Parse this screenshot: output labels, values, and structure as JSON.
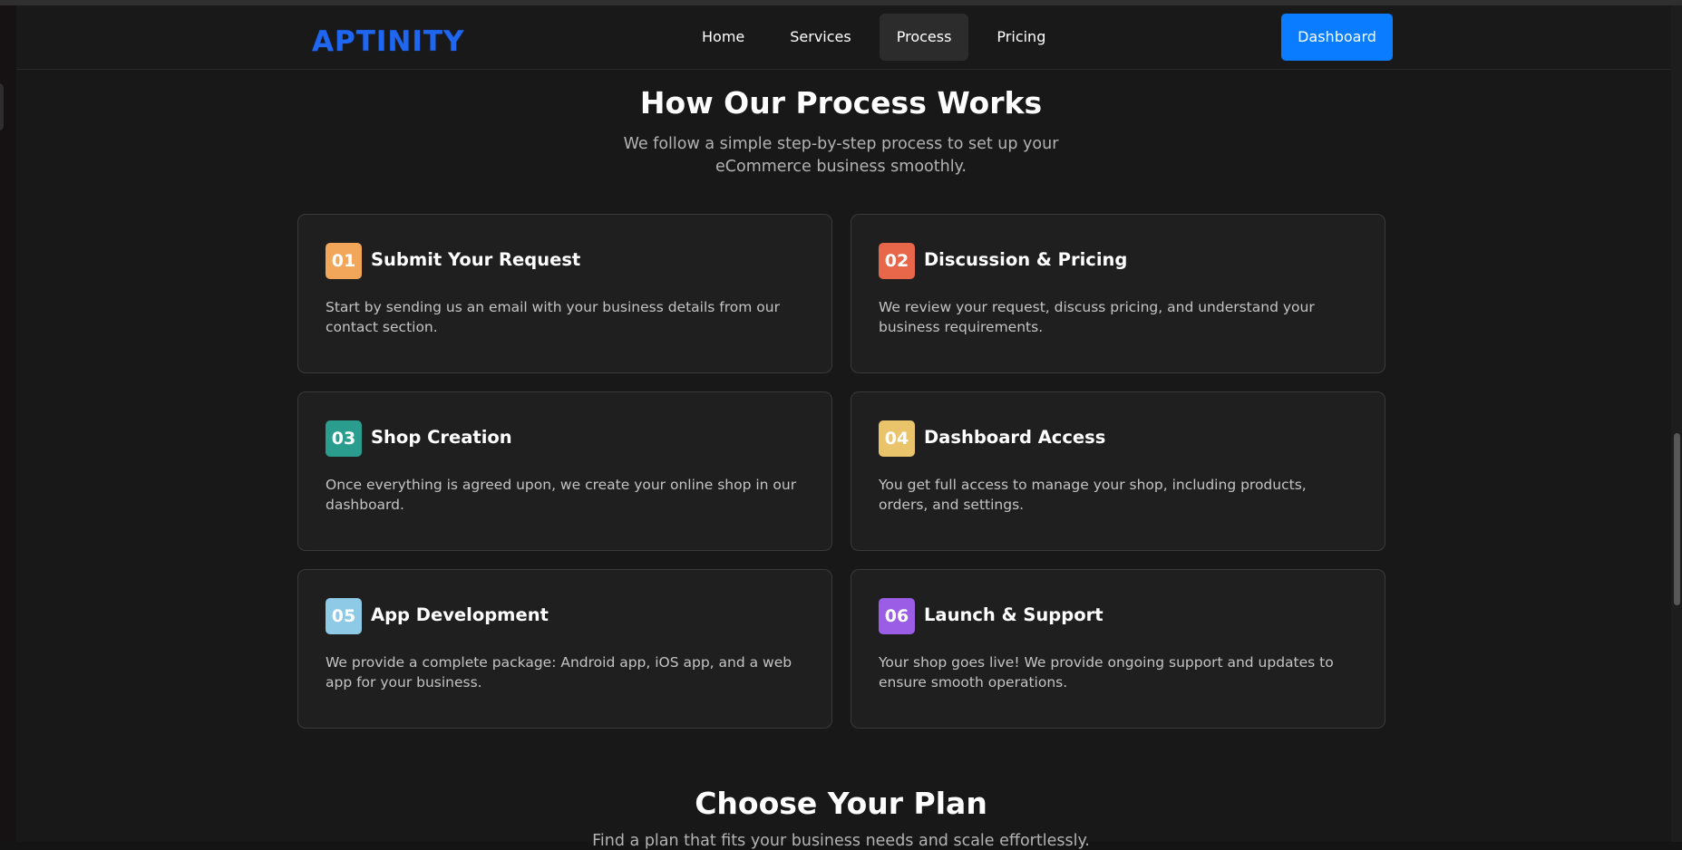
{
  "navbar": {
    "logo": "APTINITY",
    "links": [
      {
        "label": "Home",
        "active": false
      },
      {
        "label": "Services",
        "active": false
      },
      {
        "label": "Process",
        "active": true
      },
      {
        "label": "Pricing",
        "active": false
      }
    ],
    "dashboard_label": "Dashboard"
  },
  "process": {
    "title": "How Our Process Works",
    "subtitle": "We follow a simple step-by-step process to set up your eCommerce business smoothly.",
    "steps": [
      {
        "number": "01",
        "title": "Submit Your Request",
        "description": "Start by sending us an email with your business details from our contact section.",
        "color": "#f2a65a"
      },
      {
        "number": "02",
        "title": "Discussion & Pricing",
        "description": "We review your request, discuss pricing, and understand your business requirements.",
        "color": "#e8664a"
      },
      {
        "number": "03",
        "title": "Shop Creation",
        "description": "Once everything is agreed upon, we create your online shop in our dashboard.",
        "color": "#2a9d8f"
      },
      {
        "number": "04",
        "title": "Dashboard Access",
        "description": "You get full access to manage your shop, including products, orders, and settings.",
        "color": "#e9c46a"
      },
      {
        "number": "05",
        "title": "App Development",
        "description": "We provide a complete package: Android app, iOS app, and a web app for your business.",
        "color": "#8ecae6"
      },
      {
        "number": "06",
        "title": "Launch & Support",
        "description": "Your shop goes live! We provide ongoing support and updates to ensure smooth operations.",
        "color": "#9b5de5"
      }
    ]
  },
  "plans": {
    "title": "Choose Your Plan",
    "subtitle": "Find a plan that fits your business needs and scale effortlessly."
  },
  "colors": {
    "accent": "#0a7cff",
    "logo": "#1f66f0",
    "background": "#181818",
    "card": "#1f1f1f"
  }
}
